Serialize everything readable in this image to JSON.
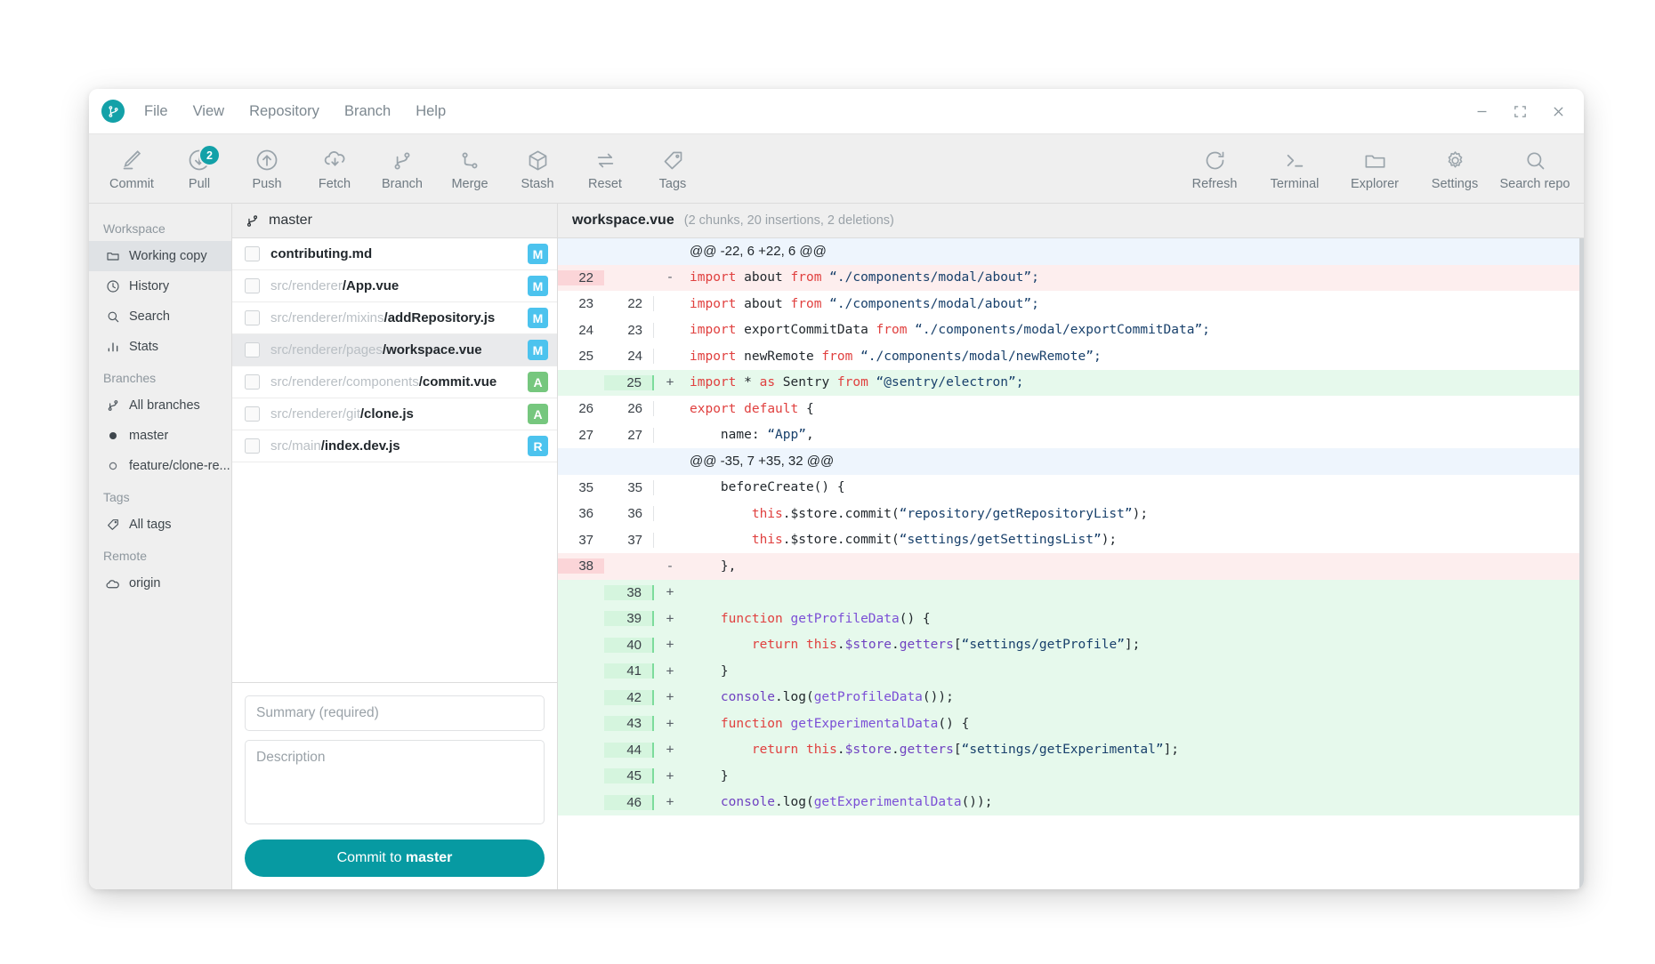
{
  "app": {
    "logo_icon": "git-branch-icon",
    "menu": [
      "File",
      "View",
      "Repository",
      "Branch",
      "Help"
    ],
    "window_controls": [
      {
        "name": "minimize-button",
        "glyph": "—"
      },
      {
        "name": "maximize-button",
        "glyph": "maximize-icon"
      },
      {
        "name": "close-button",
        "glyph": "✕"
      }
    ]
  },
  "toolbar": {
    "left": [
      {
        "label": "Commit",
        "icon": "pencil-icon",
        "badge": null
      },
      {
        "label": "Pull",
        "icon": "arrow-down-circle-icon",
        "badge": "2"
      },
      {
        "label": "Push",
        "icon": "arrow-up-circle-icon",
        "badge": null
      },
      {
        "label": "Fetch",
        "icon": "cloud-download-icon",
        "badge": null
      },
      {
        "label": "Branch",
        "icon": "branch-icon",
        "badge": null
      },
      {
        "label": "Merge",
        "icon": "merge-icon",
        "badge": null
      },
      {
        "label": "Stash",
        "icon": "box-icon",
        "badge": null
      },
      {
        "label": "Reset",
        "icon": "swap-arrows-icon",
        "badge": null
      },
      {
        "label": "Tags",
        "icon": "tag-icon",
        "badge": null
      }
    ],
    "right": [
      {
        "label": "Refresh",
        "icon": "refresh-icon"
      },
      {
        "label": "Terminal",
        "icon": "terminal-icon"
      },
      {
        "label": "Explorer",
        "icon": "folder-icon"
      },
      {
        "label": "Settings",
        "icon": "gear-icon"
      },
      {
        "label": "Search repo",
        "icon": "search-icon"
      }
    ]
  },
  "sidebar": {
    "groups": [
      {
        "title": "Workspace",
        "items": [
          {
            "label": "Working copy",
            "icon": "folder-icon",
            "active": true
          },
          {
            "label": "History",
            "icon": "clock-icon",
            "active": false
          },
          {
            "label": "Search",
            "icon": "search-icon",
            "active": false
          },
          {
            "label": "Stats",
            "icon": "bar-chart-icon",
            "active": false
          }
        ]
      },
      {
        "title": "Branches",
        "items": [
          {
            "label": "All branches",
            "icon": "branch-icon",
            "active": false
          },
          {
            "label": "master",
            "icon": "dot-filled-icon",
            "active": false
          },
          {
            "label": "feature/clone-re...",
            "icon": "dot-outline-icon",
            "active": false
          }
        ]
      },
      {
        "title": "Tags",
        "items": [
          {
            "label": "All tags",
            "icon": "tag-icon",
            "active": false
          }
        ]
      },
      {
        "title": "Remote",
        "items": [
          {
            "label": "origin",
            "icon": "cloud-icon",
            "active": false
          }
        ]
      }
    ]
  },
  "files_panel": {
    "header_icon": "branch-icon",
    "header_label": "master",
    "rows": [
      {
        "dir": "",
        "base": "contributing.md",
        "status": "M",
        "selected": false
      },
      {
        "dir": "src/renderer",
        "base": "/App.vue",
        "status": "M",
        "selected": false
      },
      {
        "dir": "src/renderer/mixins",
        "base": "/addRepository.js",
        "status": "M",
        "selected": false
      },
      {
        "dir": "src/renderer/pages",
        "base": "/workspace.vue",
        "status": "M",
        "selected": true
      },
      {
        "dir": "src/renderer/components",
        "base": "/commit.vue",
        "status": "A",
        "selected": false
      },
      {
        "dir": "src/renderer/git",
        "base": "/clone.js",
        "status": "A",
        "selected": false
      },
      {
        "dir": "src/main",
        "base": "/index.dev.js",
        "status": "R",
        "selected": false
      }
    ],
    "summary_placeholder": "Summary (required)",
    "summary_value": "",
    "description_placeholder": "Description",
    "description_value": "",
    "commit_button_prefix": "Commit to ",
    "commit_button_branch": "master"
  },
  "diff": {
    "file_name": "workspace.vue",
    "meta": "(2 chunks, 20 insertions, 2 deletions)",
    "lines": [
      {
        "type": "hunk",
        "old": "",
        "new": "",
        "sign": "",
        "tokens": [
          {
            "t": "@@ -22, 6 +22, 6 @@",
            "c": "p"
          }
        ]
      },
      {
        "type": "del",
        "old": "22",
        "new": "",
        "sign": "-",
        "tokens": [
          {
            "t": "import",
            "c": "k"
          },
          {
            "t": " about ",
            "c": "p"
          },
          {
            "t": "from",
            "c": "k"
          },
          {
            "t": " “./components/modal/about”;",
            "c": "s"
          }
        ]
      },
      {
        "type": "ctx",
        "old": "23",
        "new": "22",
        "sign": "",
        "tokens": [
          {
            "t": "import",
            "c": "k"
          },
          {
            "t": " about ",
            "c": "p"
          },
          {
            "t": "from",
            "c": "k"
          },
          {
            "t": " “./components/modal/about”;",
            "c": "s"
          }
        ]
      },
      {
        "type": "ctx",
        "old": "24",
        "new": "23",
        "sign": "",
        "tokens": [
          {
            "t": "import",
            "c": "k"
          },
          {
            "t": " exportCommitData ",
            "c": "p"
          },
          {
            "t": "from",
            "c": "k"
          },
          {
            "t": " “./components/modal/exportCommitData”;",
            "c": "s"
          }
        ]
      },
      {
        "type": "ctx",
        "old": "25",
        "new": "24",
        "sign": "",
        "tokens": [
          {
            "t": "import",
            "c": "k"
          },
          {
            "t": " newRemote ",
            "c": "p"
          },
          {
            "t": "from",
            "c": "k"
          },
          {
            "t": " “./components/modal/newRemote”;",
            "c": "s"
          }
        ]
      },
      {
        "type": "add",
        "old": "",
        "new": "25",
        "sign": "+",
        "tokens": [
          {
            "t": "import",
            "c": "k"
          },
          {
            "t": " * ",
            "c": "p"
          },
          {
            "t": "as",
            "c": "k"
          },
          {
            "t": " Sentry ",
            "c": "p"
          },
          {
            "t": "from",
            "c": "k"
          },
          {
            "t": " “@sentry/electron”;",
            "c": "s"
          }
        ]
      },
      {
        "type": "ctx",
        "old": "26",
        "new": "26",
        "sign": "",
        "tokens": [
          {
            "t": "export",
            "c": "k"
          },
          {
            "t": " ",
            "c": "p"
          },
          {
            "t": "default",
            "c": "k"
          },
          {
            "t": " {",
            "c": "p"
          }
        ]
      },
      {
        "type": "ctx",
        "old": "27",
        "new": "27",
        "sign": "",
        "tokens": [
          {
            "t": "    name: ",
            "c": "p"
          },
          {
            "t": "“App”",
            "c": "s"
          },
          {
            "t": ",",
            "c": "p"
          }
        ]
      },
      {
        "type": "hunk",
        "old": "",
        "new": "",
        "sign": "",
        "tokens": [
          {
            "t": "@@ -35, 7 +35, 32 @@",
            "c": "p"
          }
        ]
      },
      {
        "type": "ctx",
        "old": "35",
        "new": "35",
        "sign": "",
        "tokens": [
          {
            "t": "    beforeCreate() {",
            "c": "p"
          }
        ]
      },
      {
        "type": "ctx",
        "old": "36",
        "new": "36",
        "sign": "",
        "tokens": [
          {
            "t": "        ",
            "c": "p"
          },
          {
            "t": "this",
            "c": "k"
          },
          {
            "t": ".$store.commit(",
            "c": "p"
          },
          {
            "t": "“repository/getRepositoryList”",
            "c": "s"
          },
          {
            "t": ");",
            "c": "p"
          }
        ]
      },
      {
        "type": "ctx",
        "old": "37",
        "new": "37",
        "sign": "",
        "tokens": [
          {
            "t": "        ",
            "c": "p"
          },
          {
            "t": "this",
            "c": "k"
          },
          {
            "t": ".$store.commit(",
            "c": "p"
          },
          {
            "t": "“settings/getSettingsList”",
            "c": "s"
          },
          {
            "t": ");",
            "c": "p"
          }
        ]
      },
      {
        "type": "del",
        "old": "38",
        "new": "",
        "sign": "-",
        "tokens": [
          {
            "t": "    },",
            "c": "p"
          }
        ]
      },
      {
        "type": "add",
        "old": "",
        "new": "38",
        "sign": "+",
        "tokens": [
          {
            "t": "",
            "c": "p"
          }
        ]
      },
      {
        "type": "add",
        "old": "",
        "new": "39",
        "sign": "+",
        "tokens": [
          {
            "t": "    ",
            "c": "p"
          },
          {
            "t": "function",
            "c": "k"
          },
          {
            "t": " ",
            "c": "p"
          },
          {
            "t": "getProfileData",
            "c": "f"
          },
          {
            "t": "() {",
            "c": "p"
          }
        ]
      },
      {
        "type": "add",
        "old": "",
        "new": "40",
        "sign": "+",
        "tokens": [
          {
            "t": "        ",
            "c": "p"
          },
          {
            "t": "return",
            "c": "k"
          },
          {
            "t": " ",
            "c": "p"
          },
          {
            "t": "this",
            "c": "k"
          },
          {
            "t": ".",
            "c": "p"
          },
          {
            "t": "$store",
            "c": "m"
          },
          {
            "t": ".",
            "c": "p"
          },
          {
            "t": "getters",
            "c": "m"
          },
          {
            "t": "[",
            "c": "p"
          },
          {
            "t": "“settings/getProfile”",
            "c": "s"
          },
          {
            "t": "];",
            "c": "p"
          }
        ]
      },
      {
        "type": "add",
        "old": "",
        "new": "41",
        "sign": "+",
        "tokens": [
          {
            "t": "    }",
            "c": "p"
          }
        ]
      },
      {
        "type": "add",
        "old": "",
        "new": "42",
        "sign": "+",
        "tokens": [
          {
            "t": "    ",
            "c": "p"
          },
          {
            "t": "console",
            "c": "m"
          },
          {
            "t": ".log(",
            "c": "p"
          },
          {
            "t": "getProfileData",
            "c": "f"
          },
          {
            "t": "());",
            "c": "p"
          }
        ]
      },
      {
        "type": "add",
        "old": "",
        "new": "43",
        "sign": "+",
        "tokens": [
          {
            "t": "    ",
            "c": "p"
          },
          {
            "t": "function",
            "c": "k"
          },
          {
            "t": " ",
            "c": "p"
          },
          {
            "t": "getExperimentalData",
            "c": "f"
          },
          {
            "t": "() {",
            "c": "p"
          }
        ]
      },
      {
        "type": "add",
        "old": "",
        "new": "44",
        "sign": "+",
        "tokens": [
          {
            "t": "        ",
            "c": "p"
          },
          {
            "t": "return",
            "c": "k"
          },
          {
            "t": " ",
            "c": "p"
          },
          {
            "t": "this",
            "c": "k"
          },
          {
            "t": ".",
            "c": "p"
          },
          {
            "t": "$store",
            "c": "m"
          },
          {
            "t": ".",
            "c": "p"
          },
          {
            "t": "getters",
            "c": "m"
          },
          {
            "t": "[",
            "c": "p"
          },
          {
            "t": "“settings/getExperimental”",
            "c": "s"
          },
          {
            "t": "];",
            "c": "p"
          }
        ]
      },
      {
        "type": "add",
        "old": "",
        "new": "45",
        "sign": "+",
        "tokens": [
          {
            "t": "    }",
            "c": "p"
          }
        ]
      },
      {
        "type": "add",
        "old": "",
        "new": "46",
        "sign": "+",
        "tokens": [
          {
            "t": "    ",
            "c": "p"
          },
          {
            "t": "console",
            "c": "m"
          },
          {
            "t": ".log(",
            "c": "p"
          },
          {
            "t": "getExperimentalData",
            "c": "f"
          },
          {
            "t": "());",
            "c": "p"
          }
        ]
      }
    ]
  },
  "colors": {
    "accent": "#079aa2",
    "logo": "#13a1a8",
    "status_modified": "#4cc3ee",
    "status_added": "#76c77e",
    "diff_add_bg": "#e6f9ec",
    "diff_del_bg": "#fdeeee",
    "hunk_bg": "#eef5fd"
  }
}
